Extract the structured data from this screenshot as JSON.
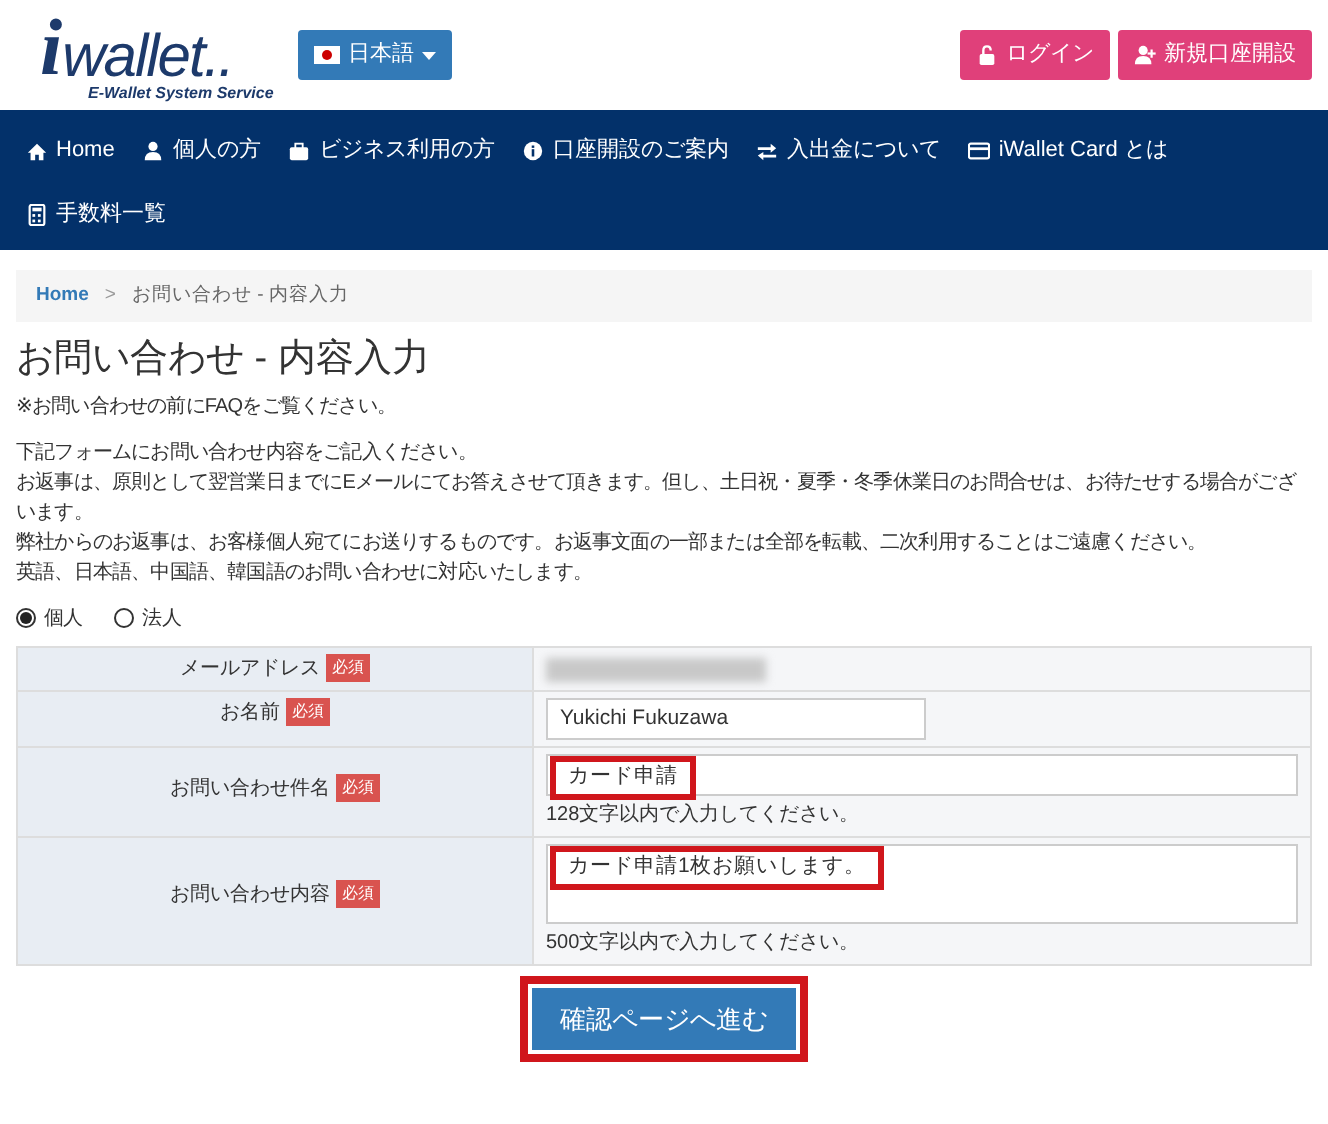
{
  "header": {
    "logo_mark": "i",
    "logo_text": "wallet..",
    "tagline": "E-Wallet System Service",
    "language": "日本語",
    "buttons": [
      "ログイン",
      "新規口座開設"
    ]
  },
  "nav": [
    "Home",
    "個人の方",
    "ビジネス利用の方",
    "口座開設のご案内",
    "入出金について",
    "iWallet Card とは",
    "手数料一覧"
  ],
  "breadcrumb": {
    "link": "Home",
    "separator": ">",
    "current": "お問い合わせ - 内容入力"
  },
  "title": "お問い合わせ - 内容入力",
  "notice": "※お問い合わせの前にFAQをご覧ください。",
  "paragraph": [
    "下記フォームにお問い合わせ内容をご記入ください。",
    "お返事は、原則として翌営業日までにEメールにてお答えさせて頂きます。但し、土日祝・夏季・冬季休業日のお問合せは、お待たせする場合がございます。",
    "弊社からのお返事は、お客様個人宛てにお送りするものです。お返事文面の一部または全部を転載、二次利用することはご遠慮ください。",
    "英語、日本語、中国語、韓国語のお問い合わせに対応いたします。"
  ],
  "account_type": [
    {
      "label": "個人",
      "selected": true
    },
    {
      "label": "法人",
      "selected": false
    }
  ],
  "form": [
    {
      "label": "メールアドレス",
      "required": "必須",
      "kind": "blurred"
    },
    {
      "label": "お名前",
      "required": "必須",
      "kind": "input",
      "value": "Yukichi Fukuzawa"
    },
    {
      "label": "お問い合わせ件名",
      "required": "必須",
      "kind": "input-wide",
      "value": "カード申請",
      "hint": "128文字以内で入力してください。",
      "highlighted": true
    },
    {
      "label": "お問い合わせ内容",
      "required": "必須",
      "kind": "textarea",
      "value": "カード申請1枚お願いします。",
      "hint": "500文字以内で入力してください。",
      "highlighted": true
    }
  ],
  "submit": {
    "label": "確認ページへ進む",
    "highlighted": true
  }
}
